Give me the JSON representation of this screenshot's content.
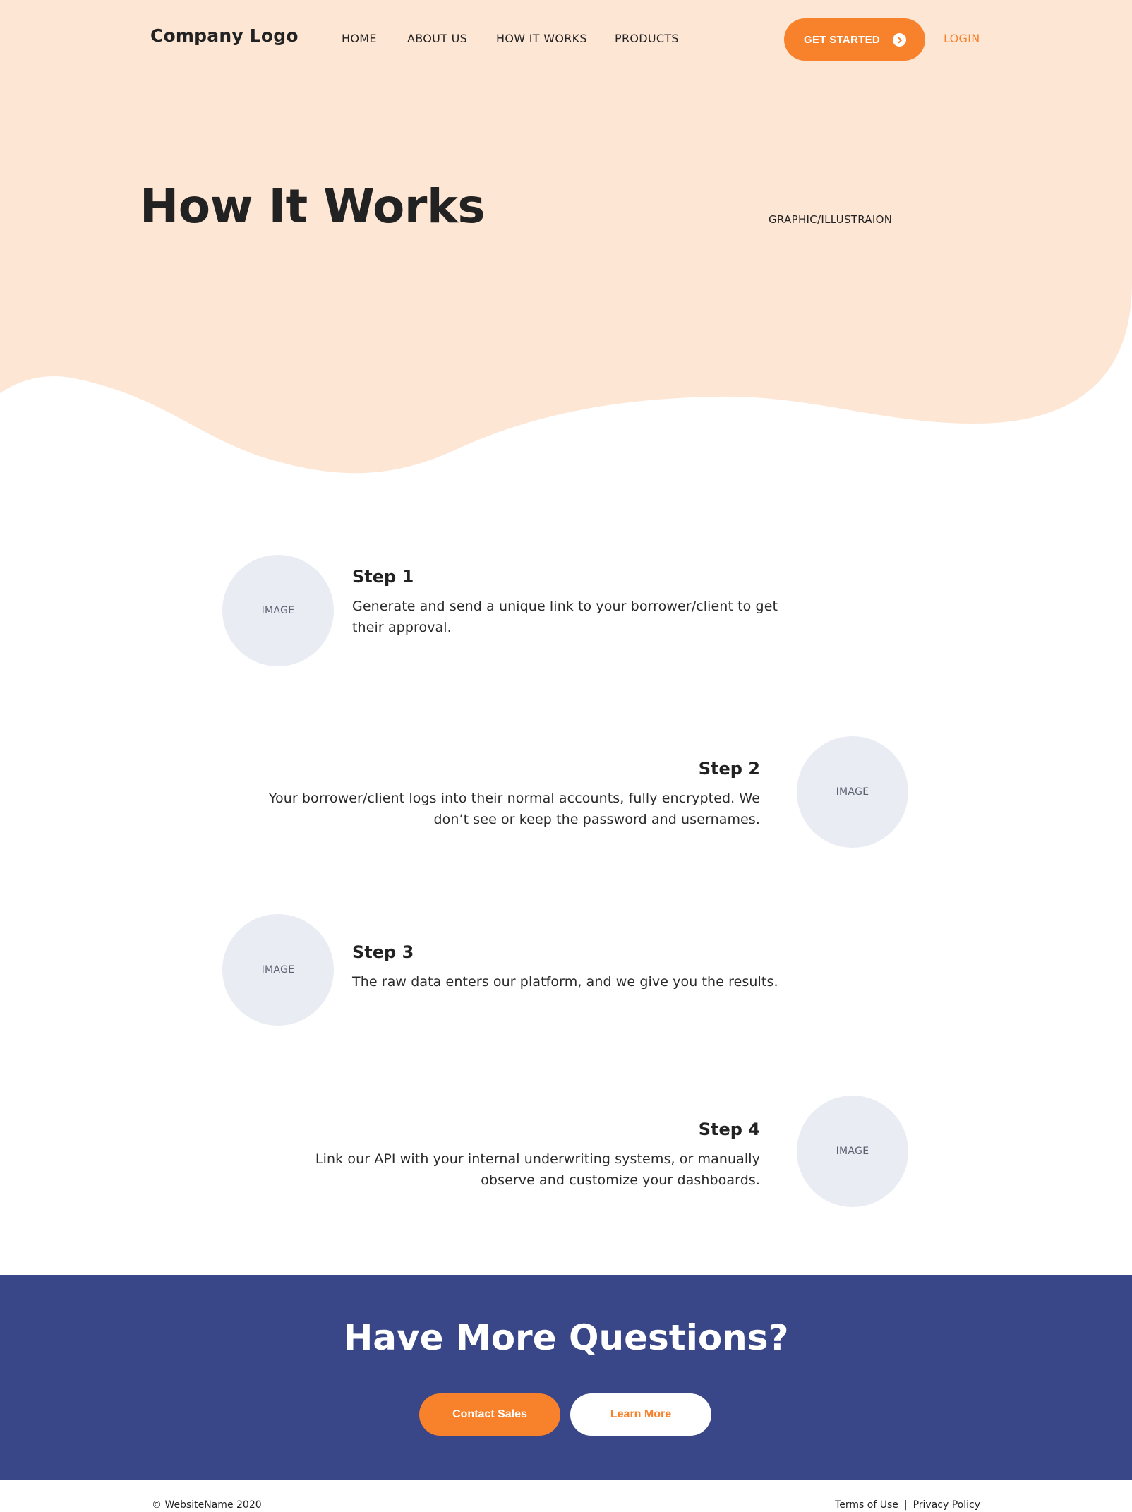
{
  "header": {
    "logo": "Company Logo",
    "nav": {
      "home": "HOME",
      "about": "ABOUT US",
      "how": "HOW IT WORKS",
      "products": "PRODUCTS"
    },
    "get_started": "GET STARTED",
    "login": "LOGIN"
  },
  "hero": {
    "title": "How It Works",
    "graphic_placeholder": "GRAPHIC/ILLUSTRAION"
  },
  "steps": [
    {
      "title": "Step 1",
      "text": "Generate and send a unique link to your borrower/client to get their approval.",
      "image_label": "IMAGE"
    },
    {
      "title": "Step 2",
      "text": "Your borrower/client logs into their normal accounts, fully encrypted. We don’t see or keep the password and usernames.",
      "image_label": "IMAGE"
    },
    {
      "title": "Step 3",
      "text": "The raw data enters our platform, and we give you the results.",
      "image_label": "IMAGE"
    },
    {
      "title": "Step 4",
      "text": "Link our API with your internal underwriting systems, or manually observe and customize your dashboards.",
      "image_label": "IMAGE"
    }
  ],
  "cta": {
    "title": "Have More Questions?",
    "contact_sales": "Contact Sales",
    "learn_more": "Learn More"
  },
  "footer": {
    "copyright": "© WebsiteName 2020",
    "terms": "Terms of Use",
    "separator": "|",
    "privacy": "Privacy Policy"
  },
  "colors": {
    "hero_bg": "#fee6d5",
    "accent": "#f8812b",
    "cta_bg": "#394687",
    "image_placeholder": "#e9ecf3"
  }
}
